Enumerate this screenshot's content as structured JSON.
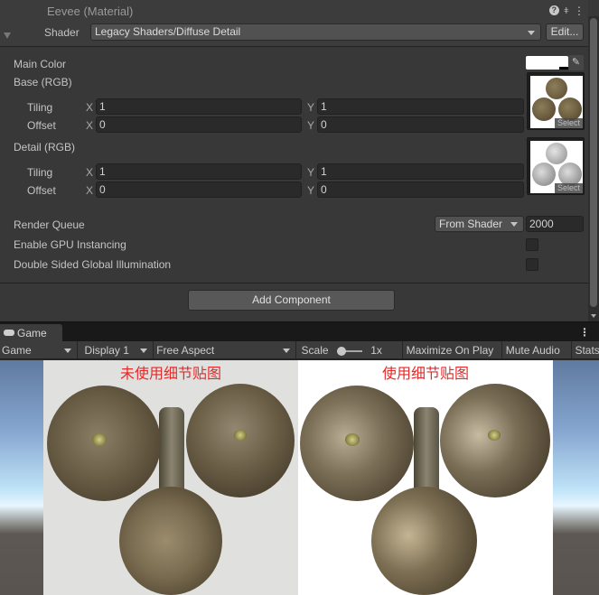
{
  "inspector": {
    "material_title": "Eevee (Material)",
    "header_icons": [
      "help-icon",
      "preset-icon",
      "more-icon"
    ],
    "shader_label": "Shader",
    "shader_value": "Legacy Shaders/Diffuse Detail",
    "edit_button": "Edit...",
    "main_color_label": "Main Color",
    "main_color_value": "#ffffff",
    "base": {
      "label": "Base (RGB)",
      "tiling_label": "Tiling",
      "offset_label": "Offset",
      "tiling_x": "1",
      "tiling_y": "1",
      "offset_x": "0",
      "offset_y": "0",
      "select_label": "Select"
    },
    "detail": {
      "label": "Detail (RGB)",
      "tiling_label": "Tiling",
      "offset_label": "Offset",
      "tiling_x": "1",
      "tiling_y": "1",
      "offset_x": "0",
      "offset_y": "0",
      "select_label": "Select"
    },
    "axis_x": "X",
    "axis_y": "Y",
    "render_queue_label": "Render Queue",
    "render_queue_mode": "From Shader",
    "render_queue_value": "2000",
    "gpu_instancing_label": "Enable GPU Instancing",
    "gpu_instancing_checked": false,
    "double_sided_gi_label": "Double Sided Global Illumination",
    "double_sided_gi_checked": false,
    "add_component_button": "Add Component"
  },
  "game": {
    "tab_label": "Game",
    "toolbar": {
      "view_mode": "Game",
      "display": "Display 1",
      "aspect": "Free Aspect",
      "scale_label": "Scale",
      "scale_value": "1x",
      "maximize_on_play": "Maximize On Play",
      "mute_audio": "Mute Audio",
      "stats": "Stats"
    },
    "captions": {
      "left": "未使用细节贴图",
      "right": "使用细节贴图"
    }
  }
}
